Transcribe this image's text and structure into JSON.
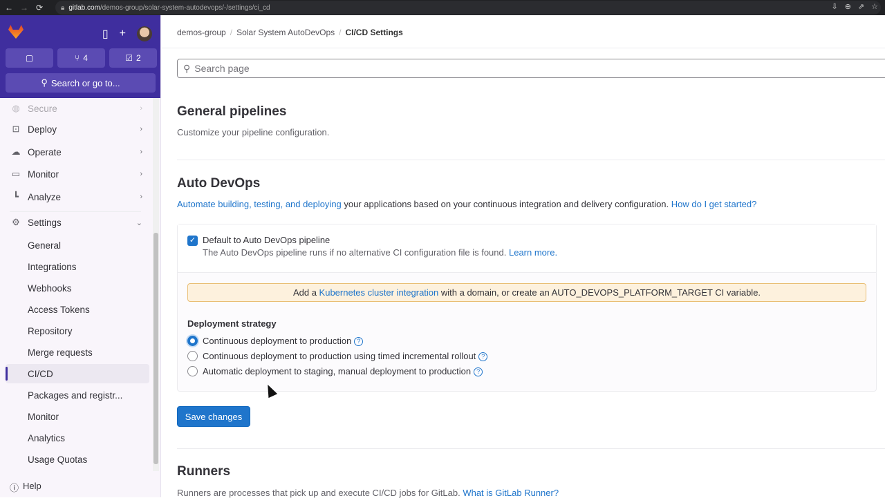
{
  "browser": {
    "url_host": "gitlab.com",
    "url_path": "/demos-group/solar-system-autodevops/-/settings/ci_cd"
  },
  "sidebar": {
    "merge_requests_count": "4",
    "todos_count": "2",
    "search_label": "Search or go to...",
    "nav": [
      {
        "label": "Secure",
        "icon": "shield-icon"
      },
      {
        "label": "Deploy",
        "icon": "deploy-icon"
      },
      {
        "label": "Operate",
        "icon": "operate-icon"
      },
      {
        "label": "Monitor",
        "icon": "monitor-icon"
      },
      {
        "label": "Analyze",
        "icon": "chart-icon"
      },
      {
        "label": "Settings",
        "icon": "gear-icon"
      }
    ],
    "settings_items": [
      "General",
      "Integrations",
      "Webhooks",
      "Access Tokens",
      "Repository",
      "Merge requests",
      "CI/CD",
      "Packages and registr...",
      "Monitor",
      "Analytics",
      "Usage Quotas"
    ],
    "help": "Help"
  },
  "breadcrumb": [
    "demos-group",
    "Solar System AutoDevOps",
    "CI/CD Settings"
  ],
  "search_placeholder": "Search page",
  "general": {
    "title": "General pipelines",
    "desc": "Customize your pipeline configuration."
  },
  "autodevops": {
    "title": "Auto DevOps",
    "desc_link": "Automate building, testing, and deploying",
    "desc_rest": " your applications based on your continuous integration and delivery configuration. ",
    "desc_link2": "How do I get started?",
    "checkbox_label": "Default to Auto DevOps pipeline",
    "checkbox_checked": true,
    "checkbox_help": "The Auto DevOps pipeline runs if no alternative CI configuration file is found. ",
    "learn_more": "Learn more.",
    "alert_pre": "Add a ",
    "alert_link": "Kubernetes cluster integration",
    "alert_post": " with a domain, or create an AUTO_DEVOPS_PLATFORM_TARGET CI variable.",
    "strategy_title": "Deployment strategy",
    "strategies": [
      "Continuous deployment to production",
      "Continuous deployment to production using timed incremental rollout",
      "Automatic deployment to staging, manual deployment to production"
    ],
    "selected_strategy": 0,
    "save": "Save changes"
  },
  "runners": {
    "title": "Runners",
    "desc": "Runners are processes that pick up and execute CI/CD jobs for GitLab. ",
    "link": "What is GitLab Runner?"
  }
}
